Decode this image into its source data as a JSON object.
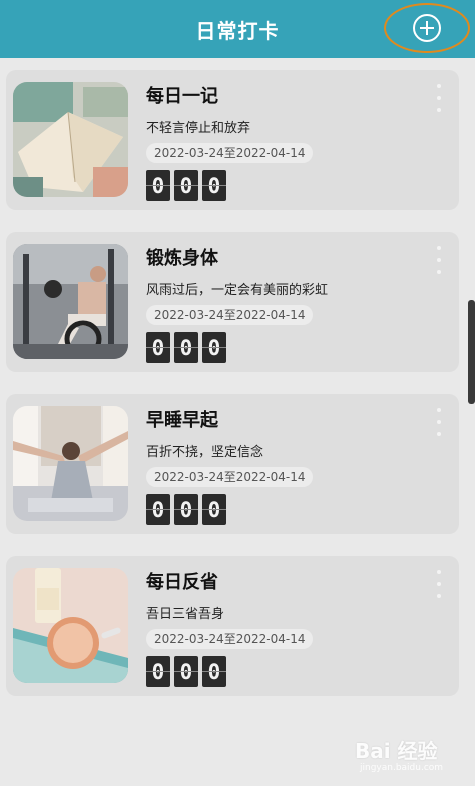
{
  "header": {
    "title": "日常打卡",
    "add_icon": "plus-circle-icon",
    "accent_color": "#36a3b8",
    "highlight_color": "#e08a1e"
  },
  "cards": [
    {
      "title": "每日一记",
      "motto": "不轻言停止和放弃",
      "date_range": "2022-03-24至2022-04-14",
      "digits": [
        "0",
        "0",
        "0"
      ],
      "image": "open-book-photo"
    },
    {
      "title": "锻炼身体",
      "motto": "风雨过后，一定会有美丽的彩虹",
      "date_range": "2022-03-24至2022-04-14",
      "digits": [
        "0",
        "0",
        "0"
      ],
      "image": "gym-workout-photo"
    },
    {
      "title": "早睡早起",
      "motto": "百折不挠，坚定信念",
      "date_range": "2022-03-24至2022-04-14",
      "digits": [
        "0",
        "0",
        "0"
      ],
      "image": "morning-stretch-photo"
    },
    {
      "title": "每日反省",
      "motto": "吾日三省吾身",
      "date_range": "2022-03-24至2022-04-14",
      "digits": [
        "0",
        "0",
        "0"
      ],
      "image": "cosmetics-flatlay-photo"
    }
  ],
  "watermark": {
    "text": "Bai 经验",
    "sub": "jingyan.baidu.com"
  }
}
